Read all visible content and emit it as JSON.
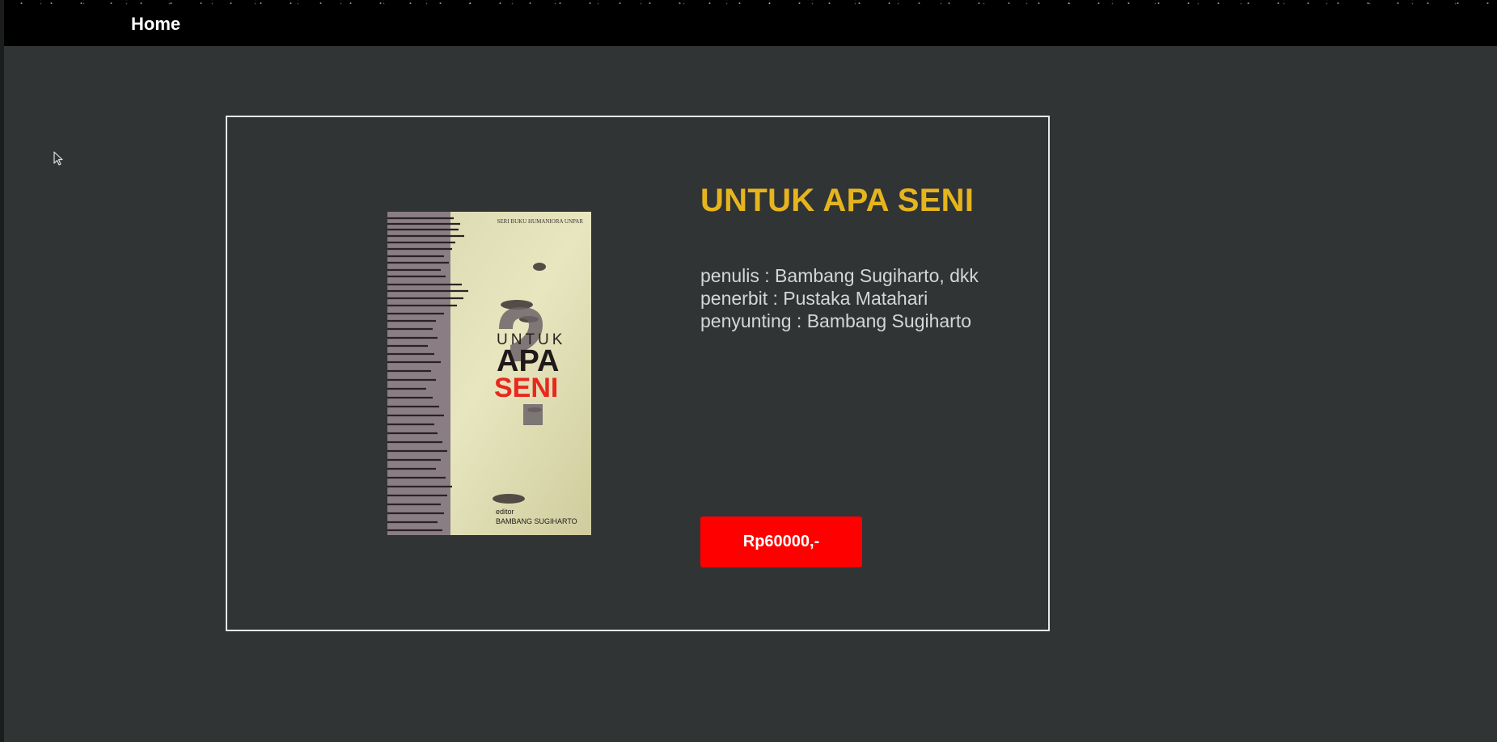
{
  "nav": {
    "home_label": "Home"
  },
  "book": {
    "title": "UNTUK APA SENI",
    "author_line": "penulis : Bambang Sugiharto, dkk",
    "publisher_line": "penerbit : Pustaka Matahari",
    "editor_line": "penyunting : Bambang Sugiharto",
    "price_label": "Rp60000,-"
  },
  "cover": {
    "series_text": "SERI BUKU HUMANIORA UNPAR",
    "title_line1": "UNTUK",
    "title_line2": "APA",
    "title_line3": "SENI",
    "editor_label": "editor",
    "editor_name": "BAMBANG SUGIHARTO"
  },
  "colors": {
    "background": "#313435",
    "navbar": "#000000",
    "title": "#e6b51d",
    "price_button": "#ff0000",
    "card_border": "#e8e8e8"
  }
}
